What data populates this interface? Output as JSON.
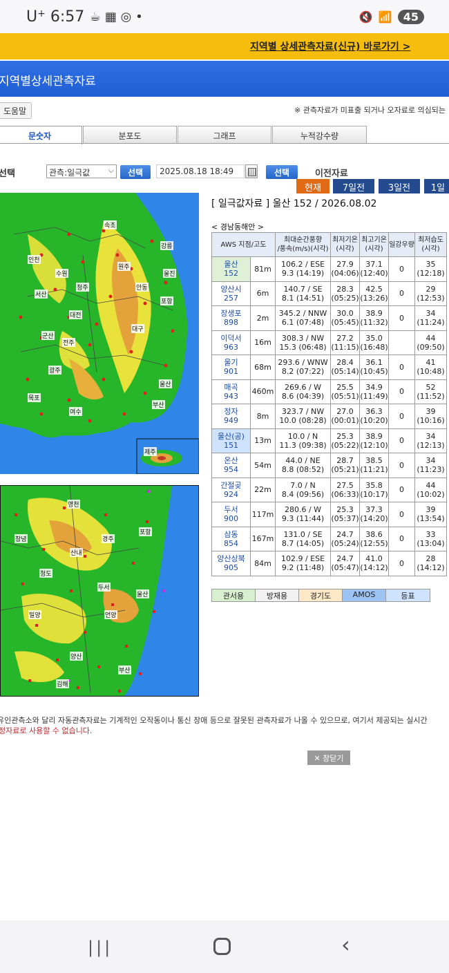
{
  "status_bar": {
    "carrier": "U",
    "carrier_suffix": "+",
    "time": "6:57",
    "battery": "45"
  },
  "banner": {
    "link_text": "지역별 상세관측자료(신규) 바로가기 >"
  },
  "page_title": "지역별상세관측자료",
  "help_button": "도움말",
  "notice": "※ 관측자료가 미표출 되거나 오자료로 의심되는",
  "tabs": [
    "문숫자",
    "분포도",
    "그래프",
    "누적강수량"
  ],
  "select_row": {
    "label": "선택",
    "dropdown_value": "관측:일극값",
    "select_button_1": "선택",
    "datetime": "2025.08.18 18:49",
    "select_button_2": "선택",
    "prev_label": "이전자료"
  },
  "period_buttons": [
    "현재",
    "7일전",
    "3일전",
    "1일"
  ],
  "table": {
    "title": "[ 일극값자료 ] 울산 152 / 2026.08.02",
    "region": "< 경남동해안 >",
    "headers": [
      [
        "AWS 지점/고도"
      ],
      [
        "최대순간풍향",
        "/풍속(m/s)(시각)"
      ],
      [
        "최저기온",
        "(시각)"
      ],
      [
        "최고기온",
        "(시각)"
      ],
      [
        "일강우량"
      ],
      [
        "최저습도",
        "(시각)"
      ]
    ],
    "rows": [
      {
        "name": "울산",
        "id": "152",
        "alt": "81m",
        "wind1": "106.2 / ESE",
        "wind2": "9.3 (14:19)",
        "tmin1": "27.9",
        "tmin2": "(04:06)",
        "tmax1": "37.1",
        "tmax2": "(12:40)",
        "rain": "0",
        "hum1": "35",
        "hum2": "(12:18)",
        "style": "green"
      },
      {
        "name": "양산시",
        "id": "257",
        "alt": "6m",
        "wind1": "140.7 / SE",
        "wind2": "8.1 (14:51)",
        "tmin1": "28.3",
        "tmin2": "(05:25)",
        "tmax1": "42.5",
        "tmax2": "(13:26)",
        "rain": "0",
        "hum1": "29",
        "hum2": "(12:53)",
        "style": ""
      },
      {
        "name": "장생포",
        "id": "898",
        "alt": "2m",
        "wind1": "345.2 / NNW",
        "wind2": "6.1 (07:48)",
        "tmin1": "30.0",
        "tmin2": "(05:45)",
        "tmax1": "38.9",
        "tmax2": "(11:32)",
        "rain": "0",
        "hum1": "34",
        "hum2": "(11:24)",
        "style": ""
      },
      {
        "name": "이덕서",
        "id": "963",
        "alt": "16m",
        "wind1": "308.3 / NW",
        "wind2": "15.3 (06:48)",
        "tmin1": "27.2",
        "tmin2": "(11:15)",
        "tmax1": "35.0",
        "tmax2": "(16:48)",
        "rain": "",
        "hum1": "44",
        "hum2": "(09:50)",
        "style": ""
      },
      {
        "name": "울기",
        "id": "901",
        "alt": "68m",
        "wind1": "293.6 / WNW",
        "wind2": "8.2 (07:22)",
        "tmin1": "28.4",
        "tmin2": "(05:14)",
        "tmax1": "36.1",
        "tmax2": "(10:45)",
        "rain": "0",
        "hum1": "41",
        "hum2": "(10:48)",
        "style": ""
      },
      {
        "name": "매곡",
        "id": "943",
        "alt": "460m",
        "wind1": "269.6 / W",
        "wind2": "8.6 (04:39)",
        "tmin1": "25.5",
        "tmin2": "(05:51)",
        "tmax1": "34.9",
        "tmax2": "(11:49)",
        "rain": "0",
        "hum1": "52",
        "hum2": "(11:52)",
        "style": ""
      },
      {
        "name": "정자",
        "id": "949",
        "alt": "8m",
        "wind1": "323.7 / NW",
        "wind2": "10.0 (08:28)",
        "tmin1": "27.0",
        "tmin2": "(00:01)",
        "tmax1": "36.3",
        "tmax2": "(10:20)",
        "rain": "0",
        "hum1": "39",
        "hum2": "(10:16)",
        "style": ""
      },
      {
        "name": "울산(공)",
        "id": "151",
        "alt": "13m",
        "wind1": "10.0 / N",
        "wind2": "11.3 (09:38)",
        "tmin1": "25.3",
        "tmin2": "(05:22)",
        "tmax1": "38.9",
        "tmax2": "(12:10)",
        "rain": "0",
        "hum1": "34",
        "hum2": "(12:13)",
        "style": "blue"
      },
      {
        "name": "온산",
        "id": "954",
        "alt": "54m",
        "wind1": "44.0 / NE",
        "wind2": "8.8 (08:52)",
        "tmin1": "28.7",
        "tmin2": "(05:21)",
        "tmax1": "38.5",
        "tmax2": "(11:21)",
        "rain": "0",
        "hum1": "34",
        "hum2": "(11:23)",
        "style": ""
      },
      {
        "name": "간절곶",
        "id": "924",
        "alt": "22m",
        "wind1": "7.0 / N",
        "wind2": "8.4 (09:56)",
        "tmin1": "27.5",
        "tmin2": "(06:33)",
        "tmax1": "35.8",
        "tmax2": "(10:17)",
        "rain": "0",
        "hum1": "44",
        "hum2": "(10:02)",
        "style": ""
      },
      {
        "name": "두서",
        "id": "900",
        "alt": "117m",
        "wind1": "280.6 / W",
        "wind2": "9.3 (11:44)",
        "tmin1": "25.3",
        "tmin2": "(05:37)",
        "tmax1": "37.3",
        "tmax2": "(14:20)",
        "rain": "0",
        "hum1": "39",
        "hum2": "(13:54)",
        "style": ""
      },
      {
        "name": "삼동",
        "id": "854",
        "alt": "167m",
        "wind1": "131.0 / SE",
        "wind2": "8.7 (14:05)",
        "tmin1": "24.7",
        "tmin2": "(05:24)",
        "tmax1": "38.6",
        "tmax2": "(12:55)",
        "rain": "0",
        "hum1": "33",
        "hum2": "(13:04)",
        "style": ""
      },
      {
        "name": "양산상북",
        "id": "905",
        "alt": "84m",
        "wind1": "102.9 / ESE",
        "wind2": "9.2 (11:48)",
        "tmin1": "24.7",
        "tmin2": "(05:47)",
        "tmax1": "41.0",
        "tmax2": "(14:12)",
        "rain": "0",
        "hum1": "28",
        "hum2": "(14:12)",
        "style": ""
      }
    ]
  },
  "legend": [
    {
      "label": "관서용",
      "color": "#d8f0cf"
    },
    {
      "label": "방재용",
      "color": "#f2f2f2"
    },
    {
      "label": "경기도",
      "color": "#fde9c8"
    },
    {
      "label": "AMOS",
      "color": "#9dc3f2"
    },
    {
      "label": "등표",
      "color": "#cfe3ff"
    }
  ],
  "map_labels_upper": [
    "속초",
    "강릉",
    "원주",
    "청주",
    "대전",
    "대구",
    "울산",
    "부산",
    "광주",
    "목포",
    "제주",
    "여수",
    "포항",
    "울진",
    "안동",
    "전주",
    "군산",
    "서산",
    "인천",
    "수원"
  ],
  "map_labels_lower": [
    "영천",
    "경주",
    "포항",
    "울산",
    "양산",
    "밀양",
    "청도",
    "창녕",
    "부산",
    "김해",
    "산내",
    "두서",
    "언양"
  ],
  "footer": {
    "line1": "유인관측소와 달리 자동관측자료는 기계적인 오작동이나 통신 장애 등으로 잘못된 관측자료가 나올 수 있으므로, 여기서 제공되는 실시간",
    "line2": "정자료로 사용할 수 없습니다."
  },
  "close_button": "✕ 창닫기"
}
